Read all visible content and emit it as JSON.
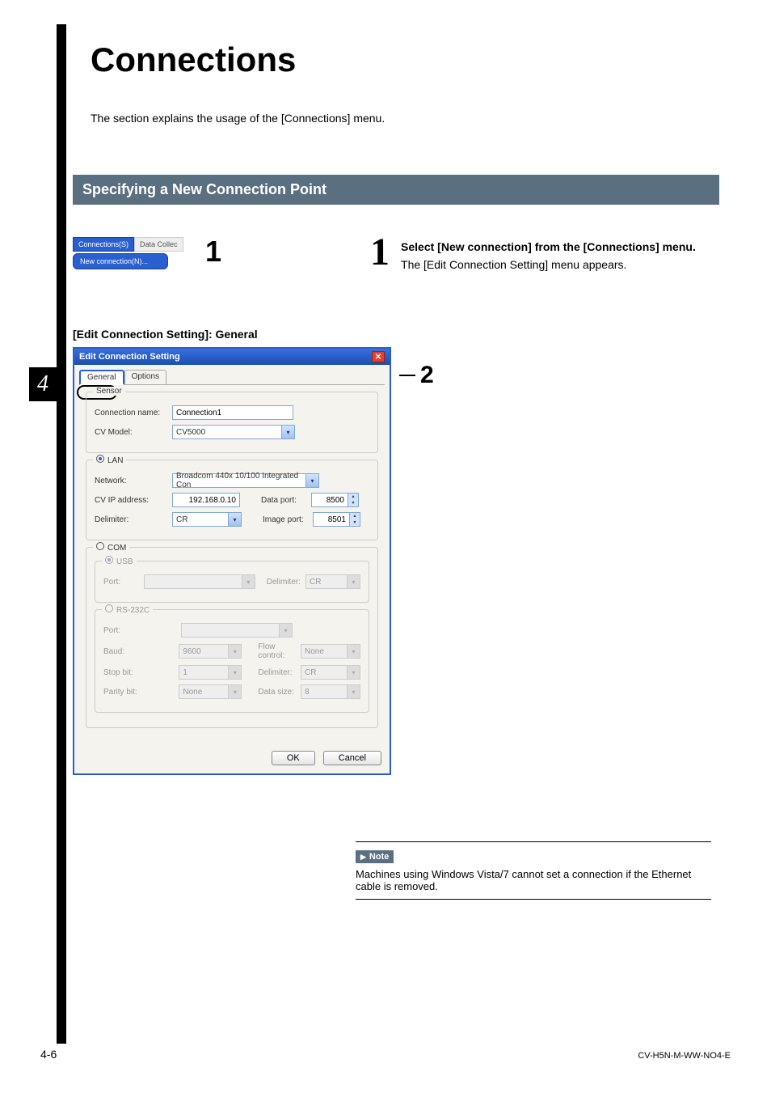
{
  "page": {
    "title": "Connections",
    "intro": "The section explains the usage of the [Connections] menu.",
    "section_heading": "Specifying a New Connection Point",
    "chapter_tab": "4",
    "page_number": "4-6",
    "doc_code": "CV-H5N-M-WW-NO4-E"
  },
  "menu_snippet": {
    "tab_active": "Connections(S)",
    "tab_grey": "Data Collec",
    "item": "New connection(N)..."
  },
  "callouts": {
    "one": "1",
    "two": "2"
  },
  "step1": {
    "number": "1",
    "bold": "Select [New connection] from the [Connections] menu.",
    "plain": "The [Edit Connection Setting] menu appears."
  },
  "subheading": "[Edit Connection Setting]: General",
  "dialog": {
    "title": "Edit Connection Setting",
    "tabs": {
      "general": "General",
      "options": "Options"
    },
    "sensor_group": "Sensor",
    "labels": {
      "connection_name": "Connection name:",
      "cv_model": "CV Model:",
      "lan": "LAN",
      "network": "Network:",
      "cv_ip": "CV IP address:",
      "data_port": "Data port:",
      "delimiter": "Delimiter:",
      "image_port": "Image port:",
      "com": "COM",
      "usb": "USB",
      "port": "Port:",
      "delimiter2": "Delimiter:",
      "rs232c": "RS-232C",
      "baud": "Baud:",
      "flow": "Flow control:",
      "stopbit": "Stop bit:",
      "parity": "Parity bit:",
      "datasize": "Data size:"
    },
    "values": {
      "connection_name": "Connection1",
      "cv_model": "CV5000",
      "network": "Broadcom 440x 10/100 Integrated Con",
      "cv_ip": "192.168.0.10",
      "data_port": "8500",
      "delimiter": "CR",
      "image_port": "8501",
      "usb_port": "",
      "usb_delimiter": "CR",
      "rs_port": "",
      "baud": "9600",
      "flow": "None",
      "stopbit": "1",
      "rs_delimiter": "CR",
      "parity": "None",
      "datasize": "8"
    },
    "buttons": {
      "ok": "OK",
      "cancel": "Cancel"
    }
  },
  "note": {
    "label": "Note",
    "text": "Machines using Windows Vista/7 cannot set a connection if the Ethernet cable is removed."
  }
}
